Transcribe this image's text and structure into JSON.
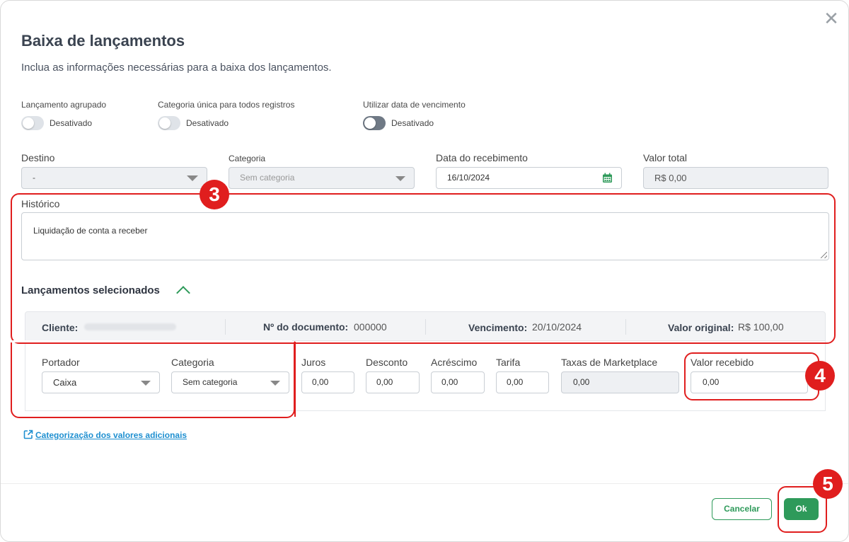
{
  "modal": {
    "close_glyph": "✕",
    "title": "Baixa de lançamentos",
    "subtitle": "Inclua as informações necessárias para a baixa dos lançamentos."
  },
  "toggles": [
    {
      "label": "Lançamento agrupado",
      "state": "Desativado"
    },
    {
      "label": "Categoria única para todos registros",
      "state": "Desativado"
    },
    {
      "label": "Utilizar data de vencimento",
      "state": "Desativado"
    }
  ],
  "fields": {
    "destino": {
      "label": "Destino",
      "value": "-"
    },
    "categoria": {
      "label": "Categoria",
      "placeholder": "Sem categoria"
    },
    "data": {
      "label": "Data do recebimento",
      "value": "16/10/2024"
    },
    "valor_total": {
      "label": "Valor total",
      "value": "R$ 0,00"
    }
  },
  "historico": {
    "label": "Histórico",
    "value": "Liquidação de conta a receber"
  },
  "selecionados": {
    "title": "Lançamentos selecionados",
    "header": {
      "cliente_label": "Cliente:",
      "documento_label": "Nº do documento:",
      "documento_value": "000000",
      "vencimento_label": "Vencimento:",
      "vencimento_value": "20/10/2024",
      "valor_label": "Valor original:",
      "valor_value": "R$ 100,00"
    },
    "row": {
      "portador": {
        "label": "Portador",
        "value": "Caixa"
      },
      "categoria": {
        "label": "Categoria",
        "value": "Sem categoria"
      },
      "juros": {
        "label": "Juros",
        "value": "0,00"
      },
      "desconto": {
        "label": "Desconto",
        "value": "0,00"
      },
      "acrescimo": {
        "label": "Acréscimo",
        "value": "0,00"
      },
      "tarifa": {
        "label": "Tarifa",
        "value": "0,00"
      },
      "marketplace": {
        "label": "Taxas de Marketplace",
        "value": "0,00"
      },
      "recebido": {
        "label": "Valor recebido",
        "value": "0,00"
      }
    }
  },
  "link": {
    "label": "Categorização dos valores adicionais"
  },
  "footer": {
    "cancel": "Cancelar",
    "ok": "Ok"
  },
  "annotations": {
    "badge3": "3",
    "badge4": "4",
    "badge5": "5"
  },
  "colors": {
    "accent": "#2e9a5a",
    "link": "#1e8fd0",
    "highlight": "#e01e1e"
  },
  "icons": {
    "calendar": "calendar-icon",
    "close": "close-icon",
    "external_link": "external-link-icon",
    "chevron": "chevron-up-icon"
  }
}
